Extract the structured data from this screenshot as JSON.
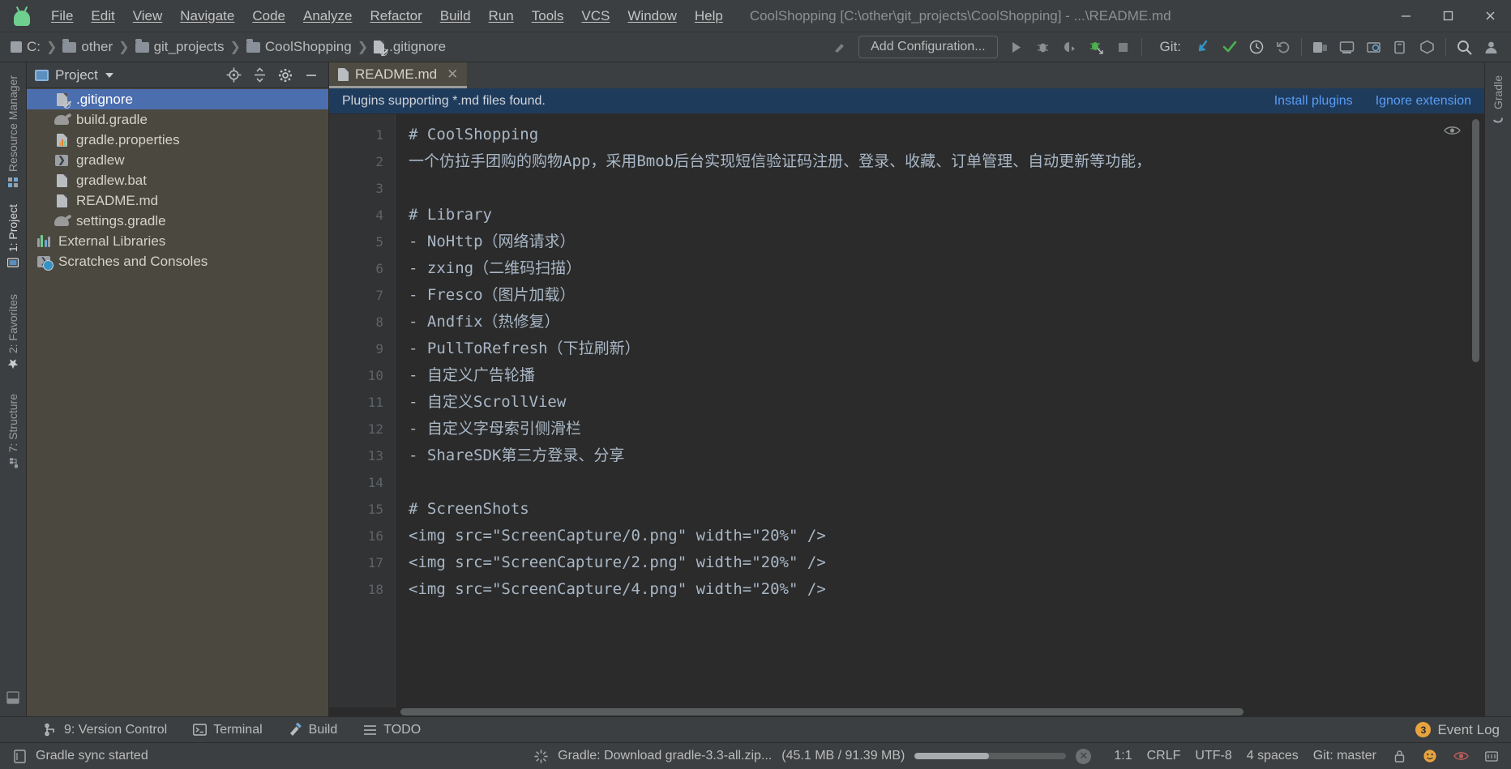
{
  "window": {
    "title": "CoolShopping [C:\\other\\git_projects\\CoolShopping] - ...\\README.md",
    "minimize_label": "—",
    "maximize_label": "□",
    "close_label": "✕"
  },
  "menu": [
    {
      "label": "File"
    },
    {
      "label": "Edit"
    },
    {
      "label": "View"
    },
    {
      "label": "Navigate"
    },
    {
      "label": "Code"
    },
    {
      "label": "Analyze"
    },
    {
      "label": "Refactor"
    },
    {
      "label": "Build"
    },
    {
      "label": "Run"
    },
    {
      "label": "Tools"
    },
    {
      "label": "VCS"
    },
    {
      "label": "Window"
    },
    {
      "label": "Help"
    }
  ],
  "breadcrumbs": [
    {
      "label": "C:",
      "icon": "drive-icon"
    },
    {
      "label": "other",
      "icon": "folder-icon"
    },
    {
      "label": "git_projects",
      "icon": "folder-icon"
    },
    {
      "label": "CoolShopping",
      "icon": "folder-icon"
    },
    {
      "label": ".gitignore",
      "icon": "gitignore-file-icon"
    }
  ],
  "toolbar": {
    "add_configuration_label": "Add Configuration...",
    "git_label": "Git:",
    "run_icon": "run-icon",
    "debug_icon": "debug-icon",
    "coverage_icon": "run-with-coverage-icon",
    "profile_icon": "profiler-icon",
    "stop_icon": "stop-icon",
    "update_project_icon": "vcs-update-icon",
    "commit_icon": "vcs-commit-icon",
    "history_icon": "vcs-history-icon",
    "rollback_icon": "vcs-rollback-icon",
    "avd_icon": "avd-manager-icon",
    "sdk_icon": "sdk-manager-icon",
    "layout_icon": "layout-inspector-icon",
    "device_icon": "device-file-explorer-icon",
    "structure_icon": "project-structure-icon",
    "search_icon": "search-everywhere-icon",
    "user_icon": "account-icon",
    "hammer_icon": "build-hammer-icon"
  },
  "rail_left": [
    {
      "label": "Resource Manager",
      "icon": "resource-manager-icon"
    },
    {
      "label": "1: Project",
      "icon": "project-icon"
    },
    {
      "label": "2: Favorites",
      "icon": "favorites-star-icon"
    },
    {
      "label": "7: Structure",
      "icon": "structure-icon"
    }
  ],
  "rail_right": [
    {
      "label": "Gradle",
      "icon": "gradle-icon"
    }
  ],
  "project_panel": {
    "title": "Project",
    "locate_icon": "locate-file-icon",
    "collapse_icon": "collapse-all-icon",
    "settings_icon": "gear-icon",
    "hide_icon": "hide-panel-icon",
    "tree": [
      {
        "label": ".gitignore",
        "icon": "gitignore-file-icon",
        "selected": true,
        "indent": 1
      },
      {
        "label": "build.gradle",
        "icon": "gradle-file-icon",
        "selected": false,
        "indent": 1
      },
      {
        "label": "gradle.properties",
        "icon": "properties-file-icon",
        "selected": false,
        "indent": 1
      },
      {
        "label": "gradlew",
        "icon": "shell-script-icon",
        "selected": false,
        "indent": 1
      },
      {
        "label": "gradlew.bat",
        "icon": "text-file-icon",
        "selected": false,
        "indent": 1
      },
      {
        "label": "README.md",
        "icon": "markdown-file-icon",
        "selected": false,
        "indent": 1
      },
      {
        "label": "settings.gradle",
        "icon": "gradle-file-icon",
        "selected": false,
        "indent": 1
      },
      {
        "label": "External Libraries",
        "icon": "libraries-icon",
        "selected": false,
        "indent": 0
      },
      {
        "label": "Scratches and Consoles",
        "icon": "scratches-icon",
        "selected": false,
        "indent": 0
      }
    ]
  },
  "editor": {
    "tabs": [
      {
        "label": "README.md",
        "icon": "markdown-file-icon",
        "close_label": "✕",
        "active": true
      }
    ],
    "notification": {
      "text": "Plugins supporting *.md files found.",
      "install_label": "Install plugins",
      "ignore_label": "Ignore extension"
    },
    "preview_icon": "eye-preview-icon",
    "lines": [
      {
        "number": "1",
        "text": "# CoolShopping"
      },
      {
        "number": "2",
        "text": "一个仿拉手团购的购物App，采用Bmob后台实现短信验证码注册、登录、收藏、订单管理、自动更新等功能，"
      },
      {
        "number": "3",
        "text": ""
      },
      {
        "number": "4",
        "text": "# Library"
      },
      {
        "number": "5",
        "text": "  - NoHttp（网络请求）"
      },
      {
        "number": "6",
        "text": "  - zxing（二维码扫描）"
      },
      {
        "number": "7",
        "text": "  - Fresco（图片加载）"
      },
      {
        "number": "8",
        "text": "  - Andfix（热修复）"
      },
      {
        "number": "9",
        "text": "  - PullToRefresh（下拉刷新）"
      },
      {
        "number": "10",
        "text": "  - 自定义广告轮播"
      },
      {
        "number": "11",
        "text": "  - 自定义ScrollView"
      },
      {
        "number": "12",
        "text": "  - 自定义字母索引侧滑栏"
      },
      {
        "number": "13",
        "text": "  - ShareSDK第三方登录、分享"
      },
      {
        "number": "14",
        "text": ""
      },
      {
        "number": "15",
        "text": "# ScreenShots"
      },
      {
        "number": "16",
        "text": "<img src=\"ScreenCapture/0.png\" width=\"20%\" />"
      },
      {
        "number": "17",
        "text": "<img src=\"ScreenCapture/2.png\" width=\"20%\" />"
      },
      {
        "number": "18",
        "text": "<img src=\"ScreenCapture/4.png\" width=\"20%\" />"
      }
    ]
  },
  "tool_windows": [
    {
      "label": "9: Version Control",
      "icon": "version-control-icon"
    },
    {
      "label": "Terminal",
      "icon": "terminal-icon"
    },
    {
      "label": "Build",
      "icon": "build-hammer-icon"
    },
    {
      "label": "TODO",
      "icon": "todo-list-icon"
    }
  ],
  "event_log": {
    "label": "Event Log",
    "count": "3"
  },
  "status_bar": {
    "message": "Gradle sync started",
    "message_icon": "ide-message-icon",
    "task": "Gradle: Download gradle-3.3-all.zip...",
    "task_detail": "(45.1 MB / 91.39 MB)",
    "task_icon": "progress-spinner-icon",
    "progress_percent": 49,
    "cancel_label": "✕",
    "caret_position": "1:1",
    "line_separator": "CRLF",
    "encoding": "UTF-8",
    "indent": "4 spaces",
    "branch": "Git: master",
    "lock_icon": "read-only-lock-icon",
    "smiley_icon": "feedback-smiley-icon",
    "inspection_icon": "inspection-eye-icon",
    "memory_icon": "memory-indicator-icon"
  },
  "colors": {
    "chrome": "#3c3f41",
    "editor_bg": "#2b2b2b",
    "gutter_bg": "#313335",
    "tree_bg": "#4b4840",
    "selection": "#4b6eaf",
    "notification_bg": "#1f3b5c",
    "link": "#589df6",
    "text": "#bbbbbb",
    "code_text": "#a9b7c6",
    "accent_green": "#6fcf8f",
    "accent_orange": "#e8a33d"
  }
}
